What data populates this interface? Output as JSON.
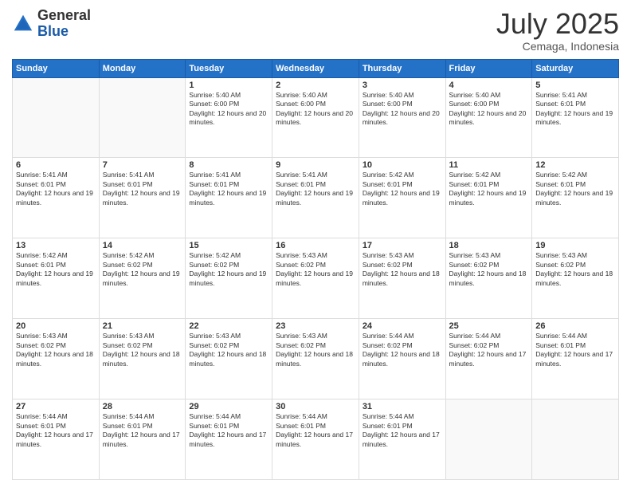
{
  "logo": {
    "general": "General",
    "blue": "Blue"
  },
  "header": {
    "month": "July 2025",
    "location": "Cemaga, Indonesia"
  },
  "weekdays": [
    "Sunday",
    "Monday",
    "Tuesday",
    "Wednesday",
    "Thursday",
    "Friday",
    "Saturday"
  ],
  "weeks": [
    [
      {
        "day": "",
        "empty": true
      },
      {
        "day": "",
        "empty": true
      },
      {
        "day": "1",
        "sunrise": "Sunrise: 5:40 AM",
        "sunset": "Sunset: 6:00 PM",
        "daylight": "Daylight: 12 hours and 20 minutes."
      },
      {
        "day": "2",
        "sunrise": "Sunrise: 5:40 AM",
        "sunset": "Sunset: 6:00 PM",
        "daylight": "Daylight: 12 hours and 20 minutes."
      },
      {
        "day": "3",
        "sunrise": "Sunrise: 5:40 AM",
        "sunset": "Sunset: 6:00 PM",
        "daylight": "Daylight: 12 hours and 20 minutes."
      },
      {
        "day": "4",
        "sunrise": "Sunrise: 5:40 AM",
        "sunset": "Sunset: 6:00 PM",
        "daylight": "Daylight: 12 hours and 20 minutes."
      },
      {
        "day": "5",
        "sunrise": "Sunrise: 5:41 AM",
        "sunset": "Sunset: 6:01 PM",
        "daylight": "Daylight: 12 hours and 19 minutes."
      }
    ],
    [
      {
        "day": "6",
        "sunrise": "Sunrise: 5:41 AM",
        "sunset": "Sunset: 6:01 PM",
        "daylight": "Daylight: 12 hours and 19 minutes."
      },
      {
        "day": "7",
        "sunrise": "Sunrise: 5:41 AM",
        "sunset": "Sunset: 6:01 PM",
        "daylight": "Daylight: 12 hours and 19 minutes."
      },
      {
        "day": "8",
        "sunrise": "Sunrise: 5:41 AM",
        "sunset": "Sunset: 6:01 PM",
        "daylight": "Daylight: 12 hours and 19 minutes."
      },
      {
        "day": "9",
        "sunrise": "Sunrise: 5:41 AM",
        "sunset": "Sunset: 6:01 PM",
        "daylight": "Daylight: 12 hours and 19 minutes."
      },
      {
        "day": "10",
        "sunrise": "Sunrise: 5:42 AM",
        "sunset": "Sunset: 6:01 PM",
        "daylight": "Daylight: 12 hours and 19 minutes."
      },
      {
        "day": "11",
        "sunrise": "Sunrise: 5:42 AM",
        "sunset": "Sunset: 6:01 PM",
        "daylight": "Daylight: 12 hours and 19 minutes."
      },
      {
        "day": "12",
        "sunrise": "Sunrise: 5:42 AM",
        "sunset": "Sunset: 6:01 PM",
        "daylight": "Daylight: 12 hours and 19 minutes."
      }
    ],
    [
      {
        "day": "13",
        "sunrise": "Sunrise: 5:42 AM",
        "sunset": "Sunset: 6:01 PM",
        "daylight": "Daylight: 12 hours and 19 minutes."
      },
      {
        "day": "14",
        "sunrise": "Sunrise: 5:42 AM",
        "sunset": "Sunset: 6:02 PM",
        "daylight": "Daylight: 12 hours and 19 minutes."
      },
      {
        "day": "15",
        "sunrise": "Sunrise: 5:42 AM",
        "sunset": "Sunset: 6:02 PM",
        "daylight": "Daylight: 12 hours and 19 minutes."
      },
      {
        "day": "16",
        "sunrise": "Sunrise: 5:43 AM",
        "sunset": "Sunset: 6:02 PM",
        "daylight": "Daylight: 12 hours and 19 minutes."
      },
      {
        "day": "17",
        "sunrise": "Sunrise: 5:43 AM",
        "sunset": "Sunset: 6:02 PM",
        "daylight": "Daylight: 12 hours and 18 minutes."
      },
      {
        "day": "18",
        "sunrise": "Sunrise: 5:43 AM",
        "sunset": "Sunset: 6:02 PM",
        "daylight": "Daylight: 12 hours and 18 minutes."
      },
      {
        "day": "19",
        "sunrise": "Sunrise: 5:43 AM",
        "sunset": "Sunset: 6:02 PM",
        "daylight": "Daylight: 12 hours and 18 minutes."
      }
    ],
    [
      {
        "day": "20",
        "sunrise": "Sunrise: 5:43 AM",
        "sunset": "Sunset: 6:02 PM",
        "daylight": "Daylight: 12 hours and 18 minutes."
      },
      {
        "day": "21",
        "sunrise": "Sunrise: 5:43 AM",
        "sunset": "Sunset: 6:02 PM",
        "daylight": "Daylight: 12 hours and 18 minutes."
      },
      {
        "day": "22",
        "sunrise": "Sunrise: 5:43 AM",
        "sunset": "Sunset: 6:02 PM",
        "daylight": "Daylight: 12 hours and 18 minutes."
      },
      {
        "day": "23",
        "sunrise": "Sunrise: 5:43 AM",
        "sunset": "Sunset: 6:02 PM",
        "daylight": "Daylight: 12 hours and 18 minutes."
      },
      {
        "day": "24",
        "sunrise": "Sunrise: 5:44 AM",
        "sunset": "Sunset: 6:02 PM",
        "daylight": "Daylight: 12 hours and 18 minutes."
      },
      {
        "day": "25",
        "sunrise": "Sunrise: 5:44 AM",
        "sunset": "Sunset: 6:02 PM",
        "daylight": "Daylight: 12 hours and 17 minutes."
      },
      {
        "day": "26",
        "sunrise": "Sunrise: 5:44 AM",
        "sunset": "Sunset: 6:01 PM",
        "daylight": "Daylight: 12 hours and 17 minutes."
      }
    ],
    [
      {
        "day": "27",
        "sunrise": "Sunrise: 5:44 AM",
        "sunset": "Sunset: 6:01 PM",
        "daylight": "Daylight: 12 hours and 17 minutes."
      },
      {
        "day": "28",
        "sunrise": "Sunrise: 5:44 AM",
        "sunset": "Sunset: 6:01 PM",
        "daylight": "Daylight: 12 hours and 17 minutes."
      },
      {
        "day": "29",
        "sunrise": "Sunrise: 5:44 AM",
        "sunset": "Sunset: 6:01 PM",
        "daylight": "Daylight: 12 hours and 17 minutes."
      },
      {
        "day": "30",
        "sunrise": "Sunrise: 5:44 AM",
        "sunset": "Sunset: 6:01 PM",
        "daylight": "Daylight: 12 hours and 17 minutes."
      },
      {
        "day": "31",
        "sunrise": "Sunrise: 5:44 AM",
        "sunset": "Sunset: 6:01 PM",
        "daylight": "Daylight: 12 hours and 17 minutes."
      },
      {
        "day": "",
        "empty": true
      },
      {
        "day": "",
        "empty": true
      }
    ]
  ]
}
